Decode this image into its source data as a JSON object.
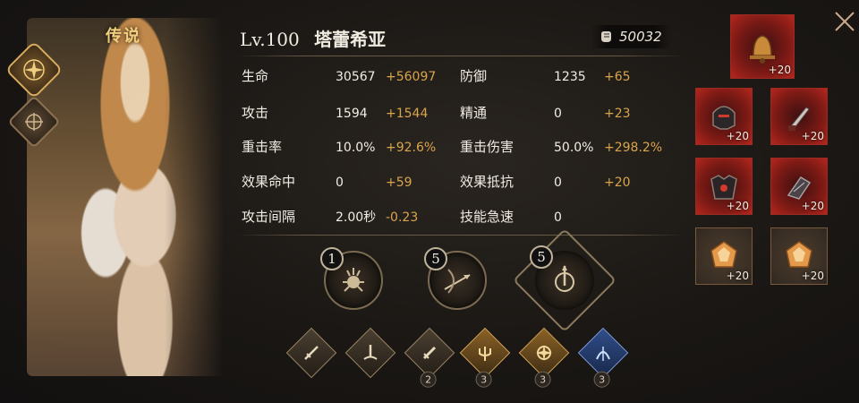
{
  "hero": {
    "rarity": "传说",
    "level": "Lv.100",
    "name": "塔蕾希亚",
    "power": "50032"
  },
  "stats": [
    {
      "label": "生命",
      "base": "30567",
      "bonus": "+56097"
    },
    {
      "label": "防御",
      "base": "1235",
      "bonus": "+65"
    },
    {
      "label": "攻击",
      "base": "1594",
      "bonus": "+1544"
    },
    {
      "label": "精通",
      "base": "0",
      "bonus": "+23"
    },
    {
      "label": "重击率",
      "base": "10.0%",
      "bonus": "+92.6%"
    },
    {
      "label": "重击伤害",
      "base": "50.0%",
      "bonus": "+298.2%"
    },
    {
      "label": "效果命中",
      "base": "0",
      "bonus": "+59"
    },
    {
      "label": "效果抵抗",
      "base": "0",
      "bonus": "+20"
    },
    {
      "label": "攻击间隔",
      "base": "2.00秒",
      "bonus": "-0.23"
    },
    {
      "label": "技能急速",
      "base": "0",
      "bonus": ""
    }
  ],
  "skills": [
    {
      "level": "1",
      "icon": "spider-crest-icon"
    },
    {
      "level": "5",
      "icon": "archer-arrow-icon"
    },
    {
      "level": "5",
      "icon": "compass-crest-icon"
    }
  ],
  "runes": [
    {
      "icon": "sword-icon",
      "count": ""
    },
    {
      "icon": "sword-in-stone-icon",
      "count": ""
    },
    {
      "icon": "dagger-icon",
      "count": "2"
    },
    {
      "icon": "trident-icon",
      "count": "3"
    },
    {
      "icon": "moon-sun-icon",
      "count": "3"
    },
    {
      "icon": "bow-icon",
      "count": "3"
    }
  ],
  "equipment": [
    {
      "slot": "artifact-bell",
      "plus": "+20"
    },
    {
      "slot": "helmet",
      "plus": "+20"
    },
    {
      "slot": "weapon-dagger",
      "plus": "+20"
    },
    {
      "slot": "armor",
      "plus": "+20"
    },
    {
      "slot": "gauntlet",
      "plus": "+20"
    },
    {
      "slot": "gem-1",
      "plus": "+20"
    },
    {
      "slot": "gem-2",
      "plus": "+20"
    }
  ],
  "colors": {
    "accent_gold": "#d9a54c",
    "text": "#f1ede4",
    "rarity": "#f0cf7e",
    "equip_red": "#b3271e"
  }
}
